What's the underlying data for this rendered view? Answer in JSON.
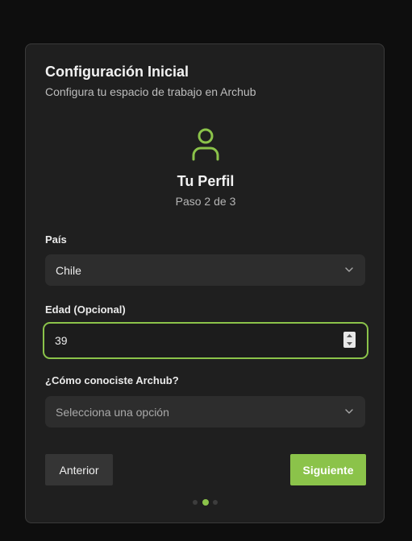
{
  "header": {
    "title": "Configuración Inicial",
    "subtitle": "Configura tu espacio de trabajo en Archub"
  },
  "step": {
    "icon": "user-icon",
    "title": "Tu Perfil",
    "progress_text": "Paso 2 de 3",
    "current": 2,
    "total": 3
  },
  "form": {
    "country": {
      "label": "País",
      "value": "Chile"
    },
    "age": {
      "label": "Edad (Opcional)",
      "value": "39"
    },
    "source": {
      "label": "¿Cómo conociste Archub?",
      "placeholder": "Selecciona una opción"
    }
  },
  "actions": {
    "prev_label": "Anterior",
    "next_label": "Siguiente"
  },
  "colors": {
    "accent": "#8bc34a",
    "background": "#0e0e0e",
    "card": "#1f1f1f",
    "input": "#2d2d2d"
  }
}
